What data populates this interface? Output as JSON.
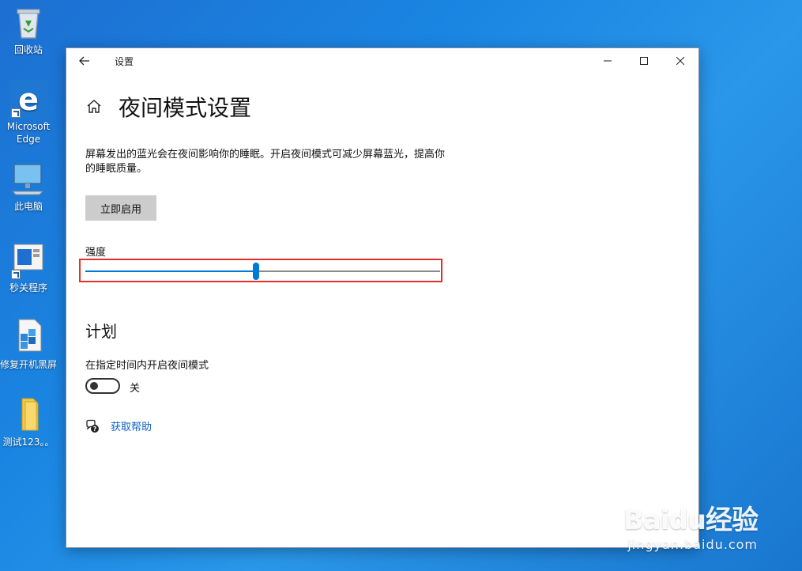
{
  "desktop": {
    "icons": [
      {
        "label": "回收站",
        "icon": "recycle-bin-icon"
      },
      {
        "label": "Microsoft Edge",
        "icon": "edge-icon"
      },
      {
        "label": "此电脑",
        "icon": "computer-icon"
      },
      {
        "label": "秒关程序",
        "icon": "app-shortcut-icon"
      },
      {
        "label": "修复开机黑屏",
        "icon": "repair-icon"
      },
      {
        "label": "测试123。。",
        "icon": "folder-icon"
      }
    ],
    "edge_label_line1": "Microsoft",
    "edge_label_line2": "Edge",
    "watermark_main": "Baidu经验",
    "watermark_sub": "jingyan.baidu.com"
  },
  "window": {
    "app_title": "设置",
    "page_title": "夜间模式设置",
    "description": "屏幕发出的蓝光会在夜间影响你的睡眠。开启夜间模式可减少屏幕蓝光，提高你的睡眠质量。",
    "enable_button": "立即启用",
    "strength_label": "强度",
    "strength_value": 0.48,
    "schedule_title": "计划",
    "schedule_toggle_label": "在指定时间内开启夜间模式",
    "schedule_toggle_state": "关",
    "help_link": "获取帮助"
  },
  "colors": {
    "accent": "#0078d7",
    "highlight": "#e0312f",
    "link": "#0a62c9"
  }
}
